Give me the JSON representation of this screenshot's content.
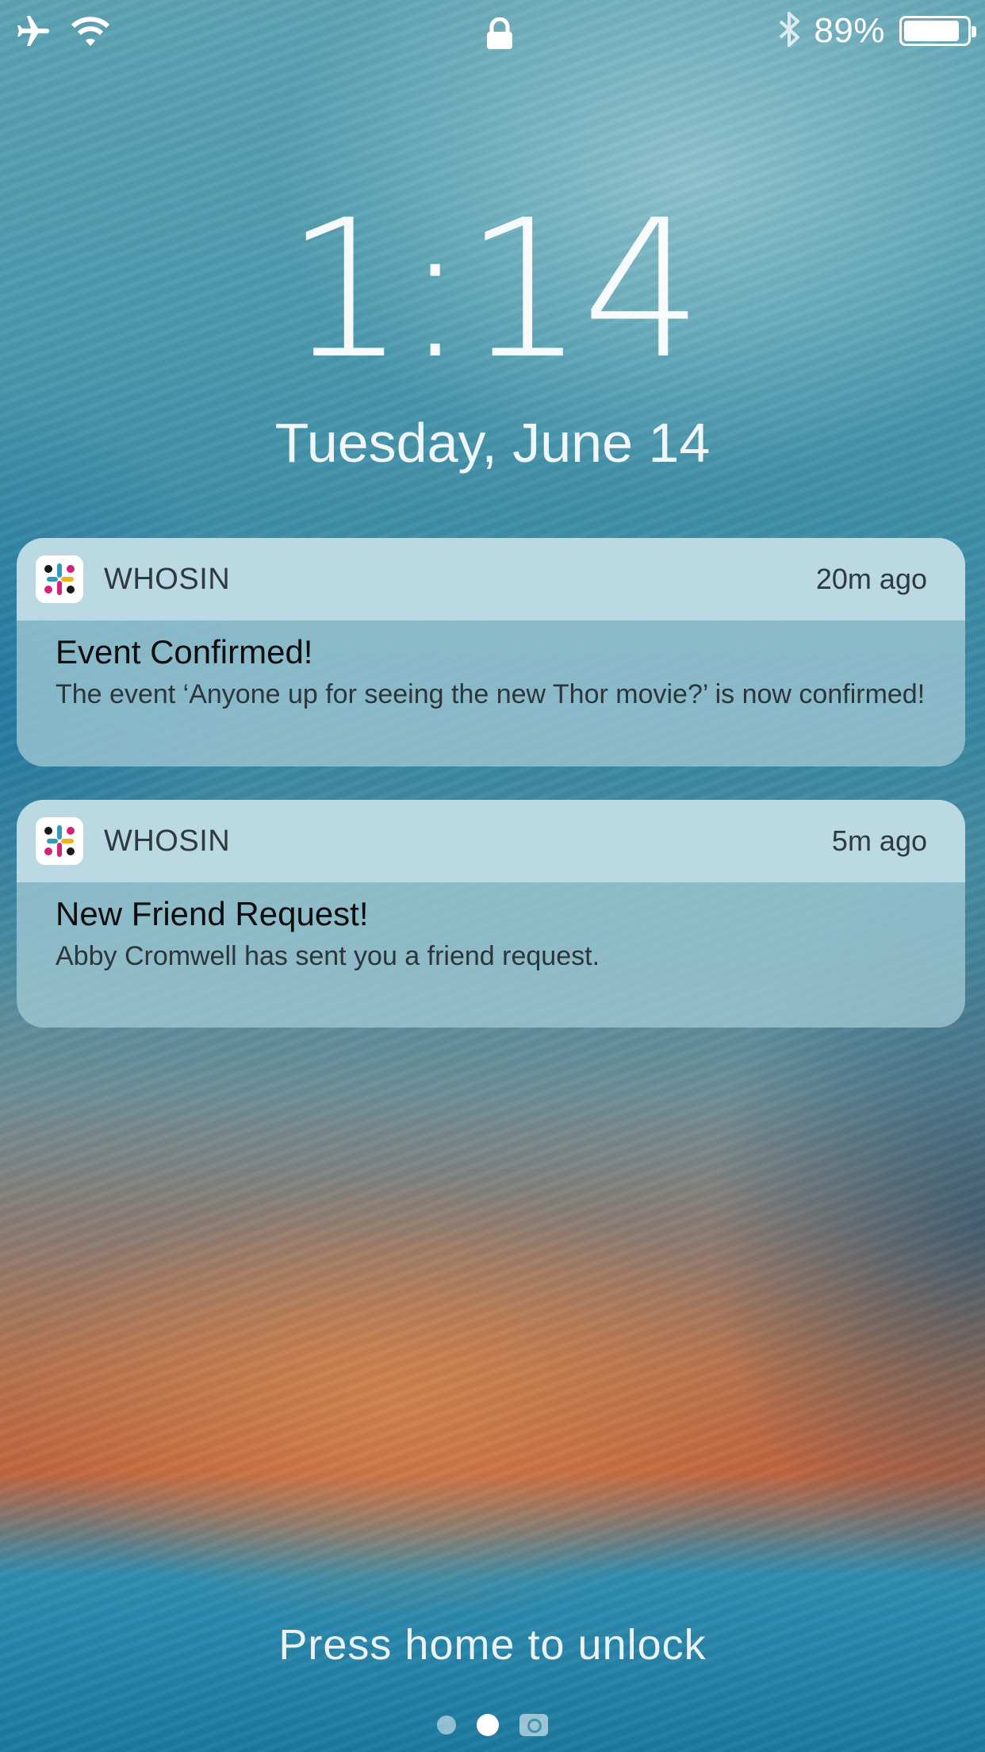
{
  "status_bar": {
    "battery_percent": "89%",
    "battery_level": 0.89,
    "icons": [
      "airplane-icon",
      "wifi-icon",
      "lock-icon",
      "bluetooth-icon",
      "battery-icon"
    ]
  },
  "lockscreen": {
    "time": "1:14",
    "date": "Tuesday, June 14",
    "unlock_hint": "Press home to unlock"
  },
  "notifications": [
    {
      "app": "WHOSIN",
      "time": "20m ago",
      "title": "Event Confirmed!",
      "message": "The event ‘Anyone up for seeing the new Thor movie?’ is now confirmed!"
    },
    {
      "app": "WHOSIN",
      "time": "5m ago",
      "title": "New Friend Request!",
      "message": "Abby Cromwell has sent you a friend request."
    }
  ],
  "colors": {
    "icon_blue": "#2f9bb8",
    "icon_magenta": "#d0247a",
    "icon_yellow": "#f2b21b",
    "icon_black": "#1a1a1a"
  }
}
